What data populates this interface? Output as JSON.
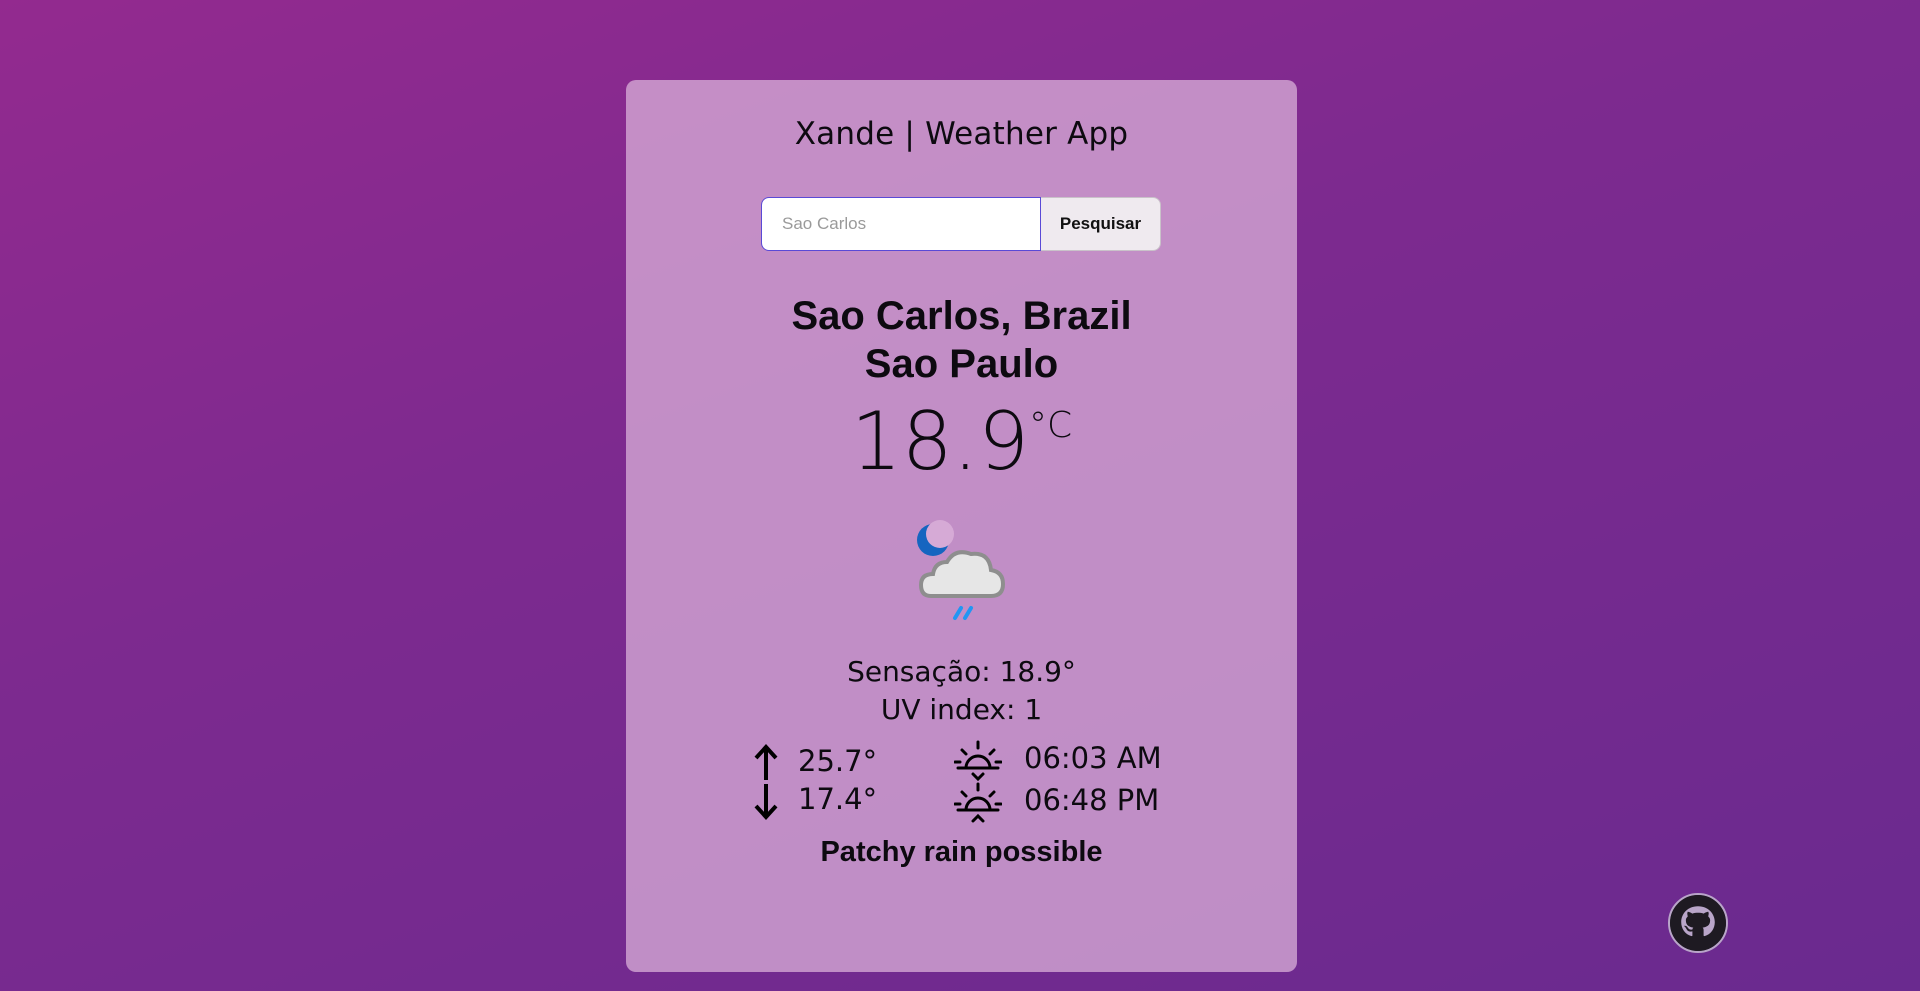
{
  "app": {
    "title": "Xande | Weather App"
  },
  "search": {
    "placeholder": "Sao Carlos",
    "value": "",
    "button_label": "Pesquisar"
  },
  "location": {
    "city_country": "Sao Carlos, Brazil",
    "region": "Sao Paulo"
  },
  "current": {
    "temperature": "18.9",
    "unit": "°C",
    "condition_icon": "partly-cloudy-night-light-rain-icon",
    "feels_like": "Sensação: 18.9°",
    "uv_index": "UV index: 1",
    "condition": "Patchy rain possible"
  },
  "forecast": {
    "max_temp": "25.7°",
    "min_temp": "17.4°",
    "sunrise": "06:03 AM",
    "sunset": "06:48 PM"
  },
  "footer": {
    "github_icon": "github-icon"
  },
  "colors": {
    "background_start": "#932a8f",
    "background_end": "#6a2a8f",
    "card": "#d6aad6",
    "input_border": "#5a4ad6",
    "moon": "#1565c0",
    "rain": "#2196f3"
  }
}
